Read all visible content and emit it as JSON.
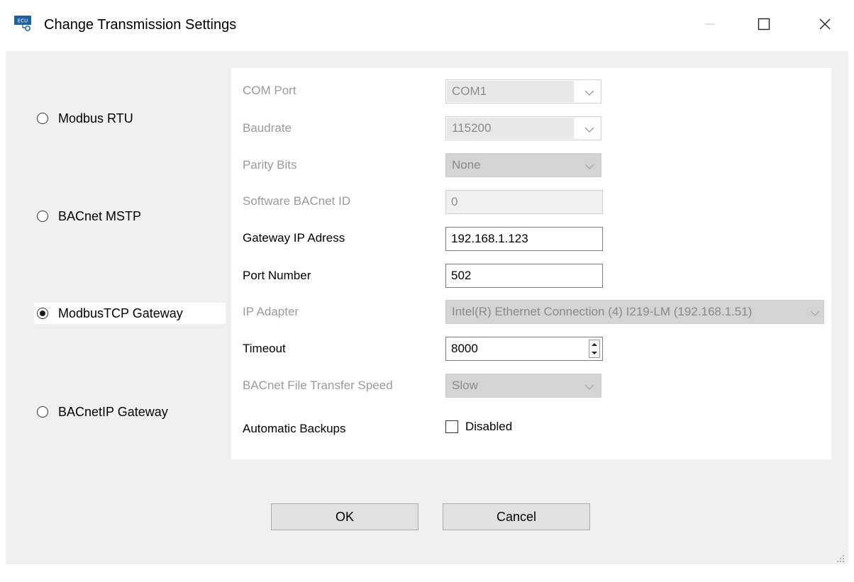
{
  "window": {
    "title": "Change Transmission Settings",
    "controls": {
      "minimize": "minimize-icon",
      "maximize": "maximize-icon",
      "close": "close-icon"
    }
  },
  "protocols": [
    {
      "label": "Modbus RTU",
      "selected": false
    },
    {
      "label": "BACnet MSTP",
      "selected": false
    },
    {
      "label": "ModbusTCP Gateway",
      "selected": true
    },
    {
      "label": "BACnetIP Gateway",
      "selected": false
    }
  ],
  "settings": {
    "com_port": {
      "label": "COM Port",
      "value": "COM1"
    },
    "baudrate": {
      "label": "Baudrate",
      "value": "115200"
    },
    "parity_bits": {
      "label": "Parity Bits",
      "value": "None"
    },
    "software_bacnet_id": {
      "label": "Software BACnet ID",
      "value": "0"
    },
    "gateway_ip": {
      "label": "Gateway IP Adress",
      "value": "192.168.1.123"
    },
    "port_number": {
      "label": "Port Number",
      "value": "502"
    },
    "ip_adapter": {
      "label": "IP Adapter",
      "value": "Intel(R) Ethernet Connection (4) I219-LM  (192.168.1.51)"
    },
    "timeout": {
      "label": "Timeout",
      "value": "8000"
    },
    "file_transfer_speed": {
      "label": "BACnet File Transfer Speed",
      "value": "Slow"
    },
    "automatic_backups": {
      "label": "Automatic Backups",
      "checkbox_label": "Disabled",
      "checked": false
    }
  },
  "buttons": {
    "ok": "OK",
    "cancel": "Cancel"
  },
  "colors": {
    "dialog_bg": "#f0f0f0",
    "panel_bg": "#ffffff",
    "disabled_text": "#9a9a9a"
  }
}
